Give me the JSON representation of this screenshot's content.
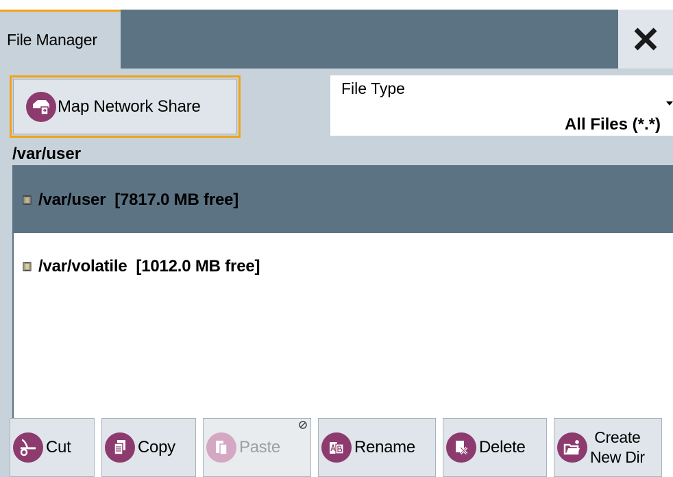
{
  "window": {
    "tab_title": "File Manager",
    "close_icon": "close-icon"
  },
  "toolbar_top": {
    "map_network_share_label": "Map Network Share",
    "file_type_label": "File Type",
    "file_type_value": "All Files (*.*)"
  },
  "current_path": "/var/user",
  "drives": [
    {
      "text": "/var/user  [7817.0 MB free]",
      "selected": true
    },
    {
      "text": "/var/volatile  [1012.0 MB free]",
      "selected": false
    }
  ],
  "actions": {
    "cut": "Cut",
    "copy": "Copy",
    "paste": "Paste",
    "rename": "Rename",
    "delete": "Delete",
    "create_new_dir_line1": "Create",
    "create_new_dir_line2": "New Dir"
  },
  "colors": {
    "accent": "#f2a314",
    "header": "#5c7384",
    "panel": "#c7d2da",
    "icon": "#8d3a6e"
  }
}
